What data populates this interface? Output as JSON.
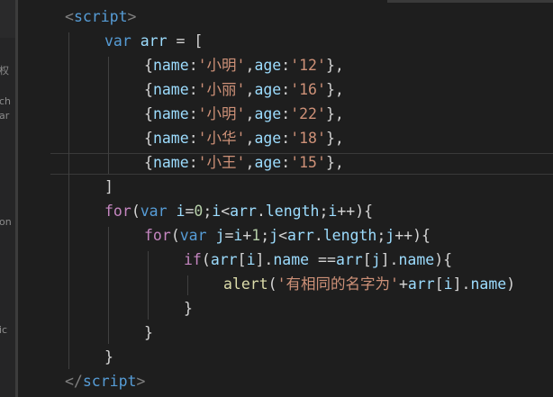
{
  "sidebar": {
    "fragments": [
      {
        "text": "权"
      },
      {
        "text": "ch"
      },
      {
        "text": "ar"
      },
      {
        "text": "on"
      },
      {
        "text": "ic"
      }
    ]
  },
  "editor": {
    "language": "javascript",
    "lines": [
      [
        {
          "t": "<",
          "c": "tk-punc"
        },
        {
          "t": "script",
          "c": "tk-tag"
        },
        {
          "t": ">",
          "c": "tk-punc"
        }
      ],
      [
        {
          "t": "var",
          "c": "tk-kw"
        },
        {
          "t": " ",
          "c": "tk-op"
        },
        {
          "t": "arr",
          "c": "tk-var"
        },
        {
          "t": " = [",
          "c": "tk-op"
        }
      ],
      [
        {
          "t": "{",
          "c": "tk-op"
        },
        {
          "t": "name",
          "c": "tk-var"
        },
        {
          "t": ":",
          "c": "tk-op"
        },
        {
          "t": "'小明'",
          "c": "tk-str"
        },
        {
          "t": ",",
          "c": "tk-op"
        },
        {
          "t": "age",
          "c": "tk-var"
        },
        {
          "t": ":",
          "c": "tk-op"
        },
        {
          "t": "'12'",
          "c": "tk-str"
        },
        {
          "t": "},",
          "c": "tk-op"
        }
      ],
      [
        {
          "t": "{",
          "c": "tk-op"
        },
        {
          "t": "name",
          "c": "tk-var"
        },
        {
          "t": ":",
          "c": "tk-op"
        },
        {
          "t": "'小丽'",
          "c": "tk-str"
        },
        {
          "t": ",",
          "c": "tk-op"
        },
        {
          "t": "age",
          "c": "tk-var"
        },
        {
          "t": ":",
          "c": "tk-op"
        },
        {
          "t": "'16'",
          "c": "tk-str"
        },
        {
          "t": "},",
          "c": "tk-op"
        }
      ],
      [
        {
          "t": "{",
          "c": "tk-op"
        },
        {
          "t": "name",
          "c": "tk-var"
        },
        {
          "t": ":",
          "c": "tk-op"
        },
        {
          "t": "'小明'",
          "c": "tk-str"
        },
        {
          "t": ",",
          "c": "tk-op"
        },
        {
          "t": "age",
          "c": "tk-var"
        },
        {
          "t": ":",
          "c": "tk-op"
        },
        {
          "t": "'22'",
          "c": "tk-str"
        },
        {
          "t": "},",
          "c": "tk-op"
        }
      ],
      [
        {
          "t": "{",
          "c": "tk-op"
        },
        {
          "t": "name",
          "c": "tk-var"
        },
        {
          "t": ":",
          "c": "tk-op"
        },
        {
          "t": "'小华'",
          "c": "tk-str"
        },
        {
          "t": ",",
          "c": "tk-op"
        },
        {
          "t": "age",
          "c": "tk-var"
        },
        {
          "t": ":",
          "c": "tk-op"
        },
        {
          "t": "'18'",
          "c": "tk-str"
        },
        {
          "t": "},",
          "c": "tk-op"
        }
      ],
      [
        {
          "t": "{",
          "c": "tk-op"
        },
        {
          "t": "name",
          "c": "tk-var"
        },
        {
          "t": ":",
          "c": "tk-op"
        },
        {
          "t": "'小王'",
          "c": "tk-str"
        },
        {
          "t": ",",
          "c": "tk-op"
        },
        {
          "t": "age",
          "c": "tk-var"
        },
        {
          "t": ":",
          "c": "tk-op"
        },
        {
          "t": "'15'",
          "c": "tk-str"
        },
        {
          "t": "},",
          "c": "tk-op"
        }
      ],
      [
        {
          "t": "]",
          "c": "tk-op"
        }
      ],
      [
        {
          "t": "for",
          "c": "tk-ctrl"
        },
        {
          "t": "(",
          "c": "tk-op"
        },
        {
          "t": "var",
          "c": "tk-kw"
        },
        {
          "t": " ",
          "c": "tk-op"
        },
        {
          "t": "i",
          "c": "tk-var"
        },
        {
          "t": "=",
          "c": "tk-op"
        },
        {
          "t": "0",
          "c": "tk-num"
        },
        {
          "t": ";",
          "c": "tk-op"
        },
        {
          "t": "i",
          "c": "tk-var"
        },
        {
          "t": "<",
          "c": "tk-op"
        },
        {
          "t": "arr",
          "c": "tk-var"
        },
        {
          "t": ".",
          "c": "tk-op"
        },
        {
          "t": "length",
          "c": "tk-var"
        },
        {
          "t": ";",
          "c": "tk-op"
        },
        {
          "t": "i",
          "c": "tk-var"
        },
        {
          "t": "++){",
          "c": "tk-op"
        }
      ],
      [
        {
          "t": "for",
          "c": "tk-ctrl"
        },
        {
          "t": "(",
          "c": "tk-op"
        },
        {
          "t": "var",
          "c": "tk-kw"
        },
        {
          "t": " ",
          "c": "tk-op"
        },
        {
          "t": "j",
          "c": "tk-var"
        },
        {
          "t": "=",
          "c": "tk-op"
        },
        {
          "t": "i",
          "c": "tk-var"
        },
        {
          "t": "+",
          "c": "tk-op"
        },
        {
          "t": "1",
          "c": "tk-num"
        },
        {
          "t": ";",
          "c": "tk-op"
        },
        {
          "t": "j",
          "c": "tk-var"
        },
        {
          "t": "<",
          "c": "tk-op"
        },
        {
          "t": "arr",
          "c": "tk-var"
        },
        {
          "t": ".",
          "c": "tk-op"
        },
        {
          "t": "length",
          "c": "tk-var"
        },
        {
          "t": ";",
          "c": "tk-op"
        },
        {
          "t": "j",
          "c": "tk-var"
        },
        {
          "t": "++){",
          "c": "tk-op"
        }
      ],
      [
        {
          "t": "if",
          "c": "tk-ctrl"
        },
        {
          "t": "(",
          "c": "tk-op"
        },
        {
          "t": "arr",
          "c": "tk-var"
        },
        {
          "t": "[",
          "c": "tk-op"
        },
        {
          "t": "i",
          "c": "tk-var"
        },
        {
          "t": "].",
          "c": "tk-op"
        },
        {
          "t": "name",
          "c": "tk-var"
        },
        {
          "t": " ==",
          "c": "tk-op"
        },
        {
          "t": "arr",
          "c": "tk-var"
        },
        {
          "t": "[",
          "c": "tk-op"
        },
        {
          "t": "j",
          "c": "tk-var"
        },
        {
          "t": "].",
          "c": "tk-op"
        },
        {
          "t": "name",
          "c": "tk-var"
        },
        {
          "t": "){",
          "c": "tk-op"
        }
      ],
      [
        {
          "t": "alert",
          "c": "tk-fn"
        },
        {
          "t": "(",
          "c": "tk-op"
        },
        {
          "t": "'有相同的名字为'",
          "c": "tk-str"
        },
        {
          "t": "+",
          "c": "tk-op"
        },
        {
          "t": "arr",
          "c": "tk-var"
        },
        {
          "t": "[",
          "c": "tk-op"
        },
        {
          "t": "i",
          "c": "tk-var"
        },
        {
          "t": "].",
          "c": "tk-op"
        },
        {
          "t": "name",
          "c": "tk-var"
        },
        {
          "t": ")",
          "c": "tk-op"
        }
      ],
      [
        {
          "t": "}",
          "c": "tk-op"
        }
      ],
      [
        {
          "t": "}",
          "c": "tk-op"
        }
      ],
      [
        {
          "t": "}",
          "c": "tk-op"
        }
      ],
      [
        {
          "t": "</",
          "c": "tk-punc"
        },
        {
          "t": "script",
          "c": "tk-tag"
        },
        {
          "t": ">",
          "c": "tk-punc"
        }
      ]
    ]
  },
  "theme": {
    "background": "#1e1e1e",
    "keyword": "#569cd6",
    "control": "#c586c0",
    "variable": "#9cdcfe",
    "string": "#ce9178",
    "number": "#b5cea8",
    "function": "#dcdcaa",
    "punctuation": "#808080"
  }
}
